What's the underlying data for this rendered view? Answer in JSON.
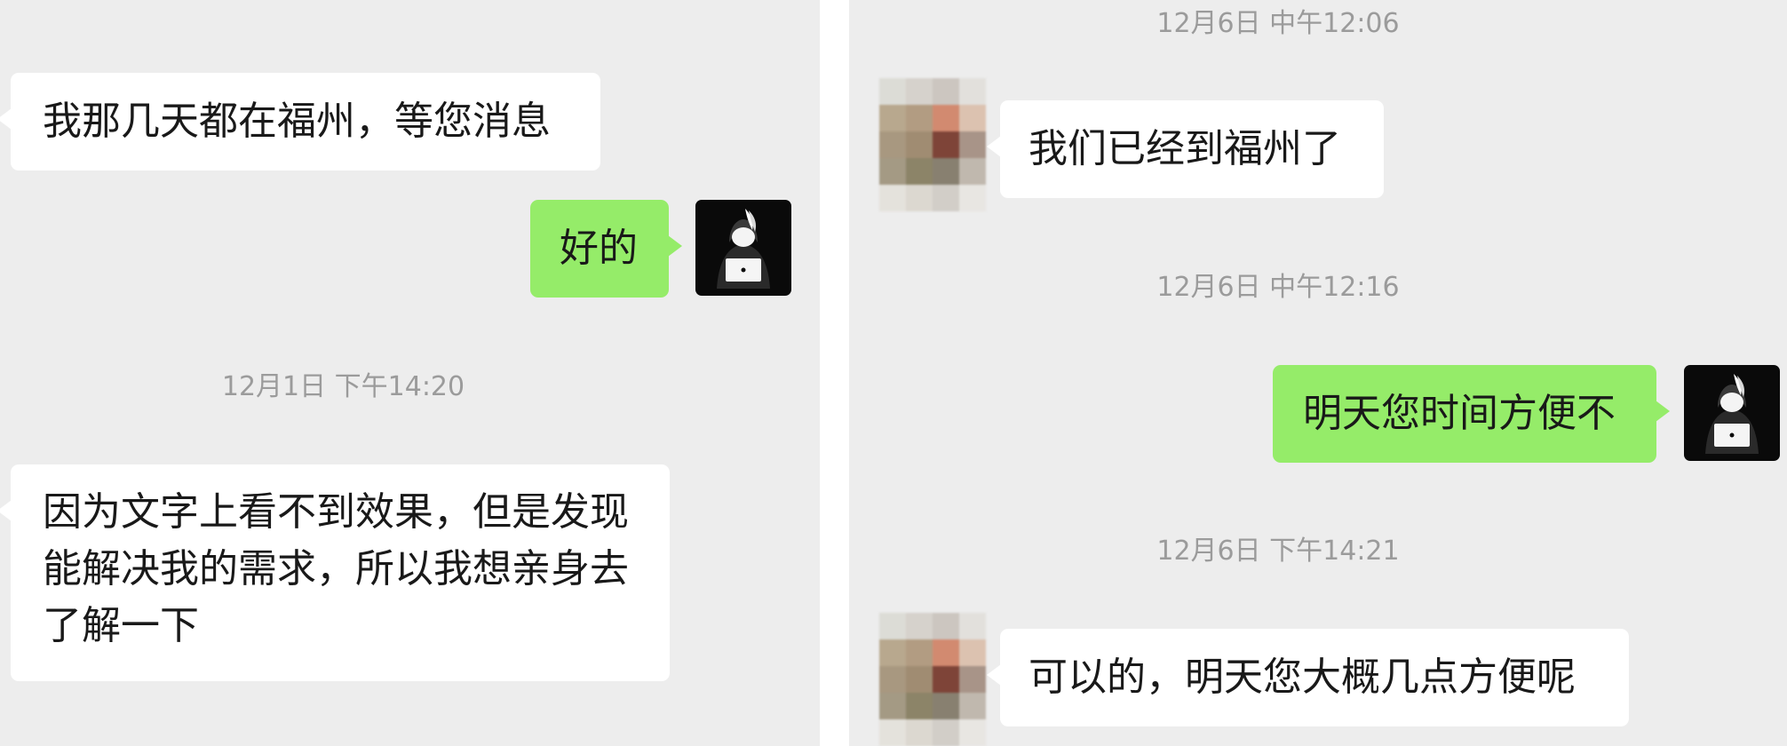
{
  "left_panel": {
    "messages": [
      {
        "type": "received",
        "text": "我那几天都在福州，等您消息"
      },
      {
        "type": "sent",
        "text": "好的"
      },
      {
        "type": "timestamp",
        "text": "12月1日 下午14:20"
      },
      {
        "type": "received",
        "lines": [
          "因为文字上看不到效果，但是发现",
          "能解决我的需求，所以我想亲身去",
          "了解一下"
        ]
      }
    ]
  },
  "right_panel": {
    "messages": [
      {
        "type": "timestamp",
        "text": "12月6日 中午12:06"
      },
      {
        "type": "received",
        "text": "我们已经到福州了"
      },
      {
        "type": "timestamp",
        "text": "12月6日 中午12:16"
      },
      {
        "type": "sent",
        "text": "明天您时间方便不"
      },
      {
        "type": "timestamp",
        "text": "12月6日 下午14:21"
      },
      {
        "type": "received",
        "text": "可以的，明天您大概几点方便呢"
      }
    ]
  },
  "avatars": {
    "self": "hooded-figure-laptop-icon",
    "contact": "pixelated-contact-avatar"
  },
  "colors": {
    "chat_background": "#ededed",
    "sent_bubble": "#95ec69",
    "received_bubble": "#ffffff",
    "timestamp_text": "#9b9b9b"
  }
}
